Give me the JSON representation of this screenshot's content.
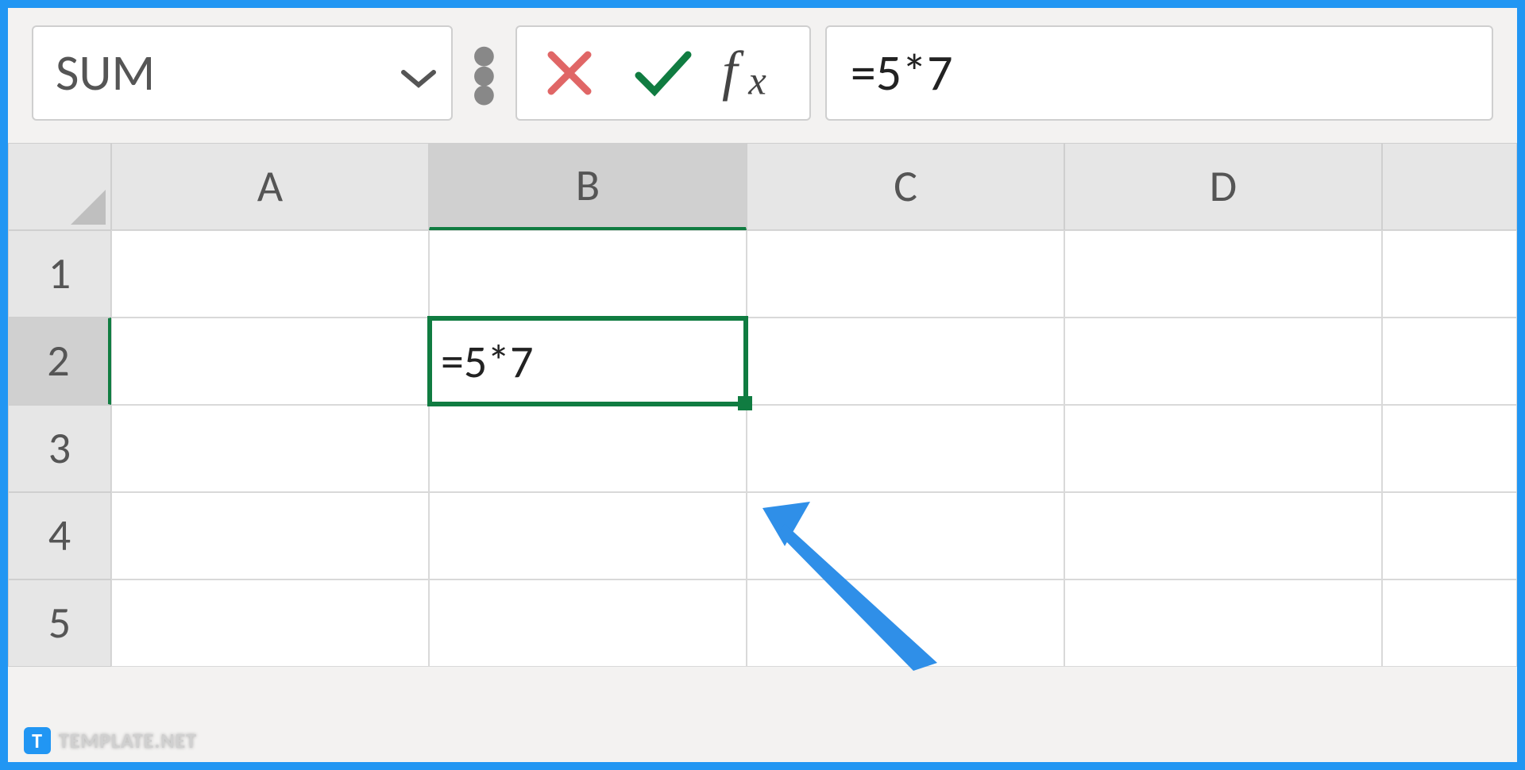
{
  "formula_bar": {
    "name_box": "SUM",
    "formula": "=5*7"
  },
  "columns": [
    "A",
    "B",
    "C",
    "D",
    ""
  ],
  "rows": [
    "1",
    "2",
    "3",
    "4",
    "5"
  ],
  "selected": {
    "col_index": 1,
    "row_index": 1,
    "col_label": "B",
    "row_label": "2",
    "cell_value": "=5*7"
  },
  "watermark": {
    "badge": "T",
    "text": "TEMPLATE.NET"
  }
}
